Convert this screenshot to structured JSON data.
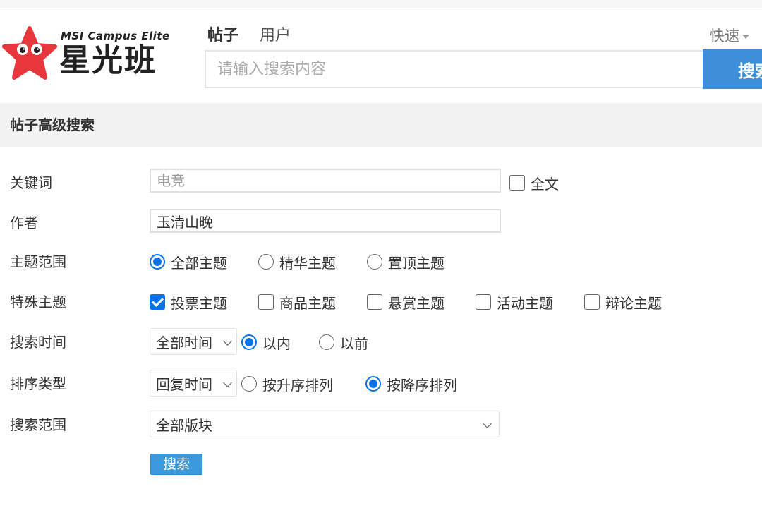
{
  "logo": {
    "english": "MSI Campus Elite",
    "chinese": "星光班",
    "color": "#e8373c"
  },
  "search": {
    "tabs": [
      "帖子",
      "用户"
    ],
    "active_tab": "帖子",
    "placeholder": "请输入搜索内容",
    "value": "",
    "button_label": "搜索",
    "quick_link": "快速"
  },
  "advanced": {
    "title": "帖子高级搜索",
    "keyword": {
      "label": "关键词",
      "placeholder": "电竞",
      "fulltext_label": "全文",
      "fulltext_checked": false
    },
    "author": {
      "label": "作者",
      "value": "玉清山晚"
    },
    "topic_scope": {
      "label": "主题范围",
      "options": [
        "全部主题",
        "精华主题",
        "置顶主题"
      ],
      "selected": "全部主题"
    },
    "special_topic": {
      "label": "特殊主题",
      "options": [
        {
          "label": "投票主题",
          "checked": true
        },
        {
          "label": "商品主题",
          "checked": false
        },
        {
          "label": "悬赏主题",
          "checked": false
        },
        {
          "label": "活动主题",
          "checked": false
        },
        {
          "label": "辩论主题",
          "checked": false
        }
      ]
    },
    "search_time": {
      "label": "搜索时间",
      "select_value": "全部时间",
      "options": [
        "以内",
        "以前"
      ],
      "selected": "以内"
    },
    "sort_type": {
      "label": "排序类型",
      "select_value": "回复时间",
      "options": [
        "按升序排列",
        "按降序排列"
      ],
      "selected": "按降序排列"
    },
    "search_scope": {
      "label": "搜索范围",
      "select_value": "全部版块"
    },
    "submit_label": "搜索"
  },
  "colors": {
    "accent": "#0a72e8",
    "button": "#3c99dc",
    "section_bg": "#f2f2f2"
  }
}
